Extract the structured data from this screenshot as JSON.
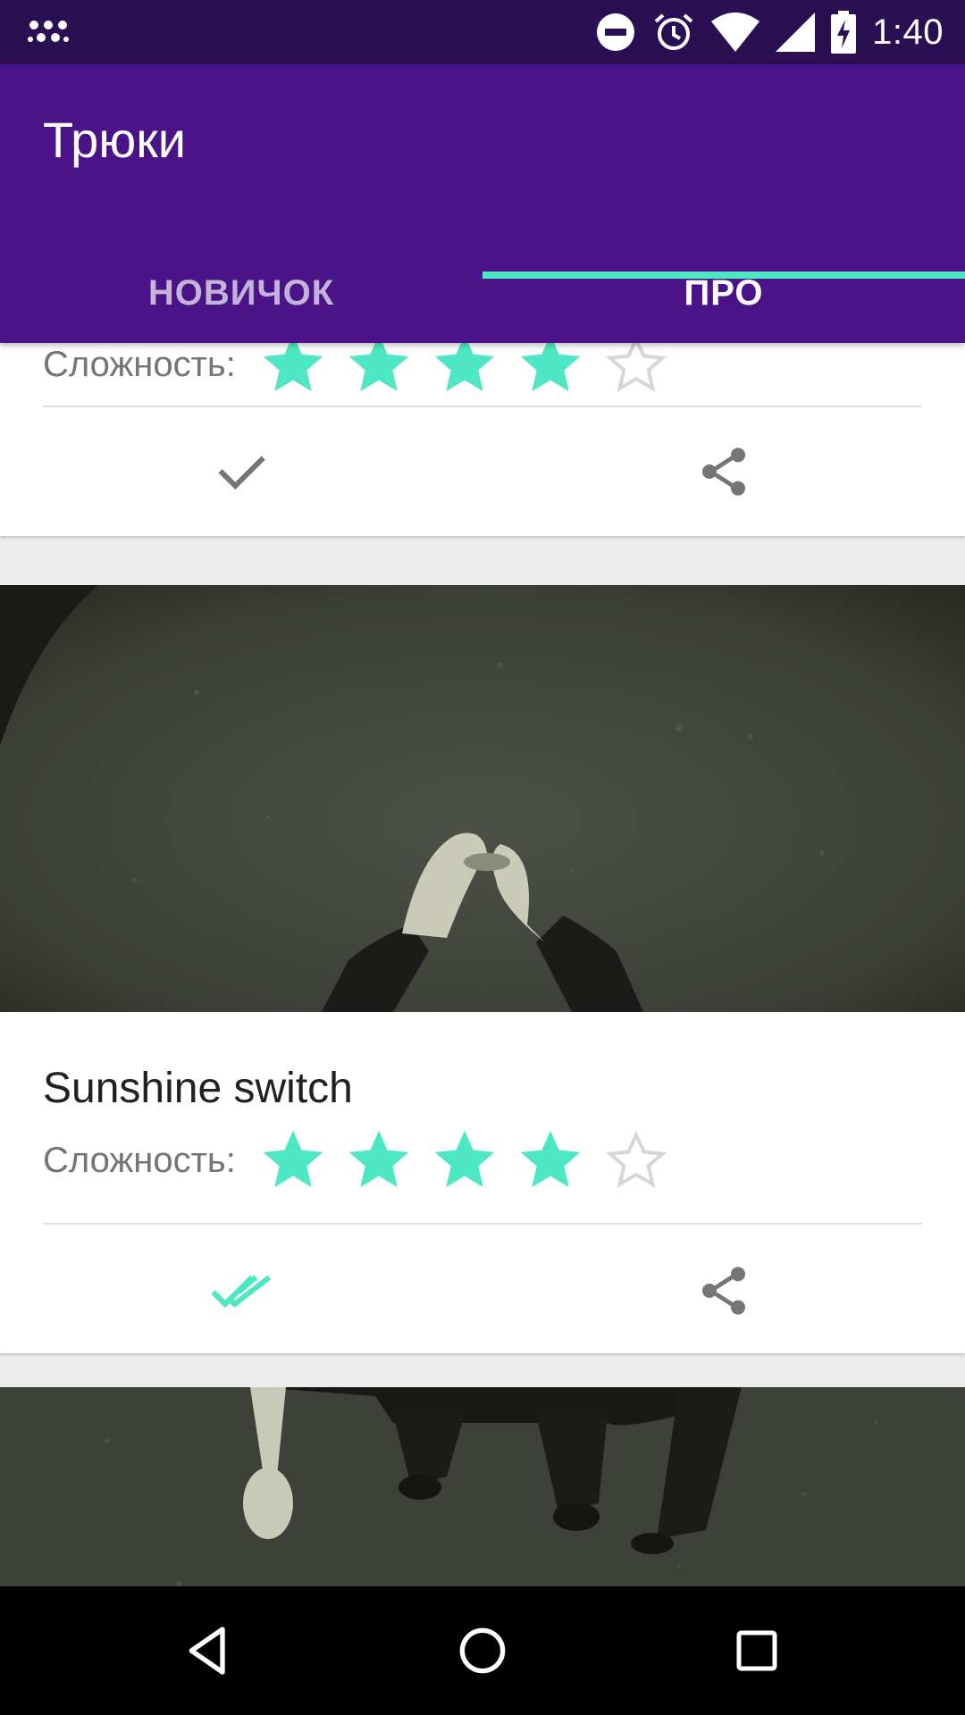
{
  "status_bar": {
    "time": "1:40",
    "icons": [
      "notification-dots-icon",
      "do-not-disturb-icon",
      "alarm-icon",
      "wifi-icon",
      "cell-signal-icon",
      "battery-charging-icon"
    ]
  },
  "app_bar": {
    "title": "Трюки",
    "tabs": [
      {
        "label": "НОВИЧОК",
        "active": false
      },
      {
        "label": "ПРО",
        "active": true
      }
    ]
  },
  "cards": [
    {
      "title": "",
      "difficulty_label": "Сложность:",
      "rating": 4,
      "rating_max": 5,
      "status_icon": "check-icon",
      "share_icon": "share-icon"
    },
    {
      "title": "Sunshine switch",
      "difficulty_label": "Сложность:",
      "rating": 4,
      "rating_max": 5,
      "status_icon": "double-check-icon",
      "share_icon": "share-icon"
    }
  ],
  "nav_bar": {
    "buttons": [
      "back-icon",
      "home-icon",
      "recents-icon"
    ]
  },
  "colors": {
    "status_bar": "#2a0f52",
    "app_bar": "#4a1488",
    "accent": "#4de8c3",
    "star_empty": "#d6d6d6",
    "icon_gray": "#757575"
  }
}
